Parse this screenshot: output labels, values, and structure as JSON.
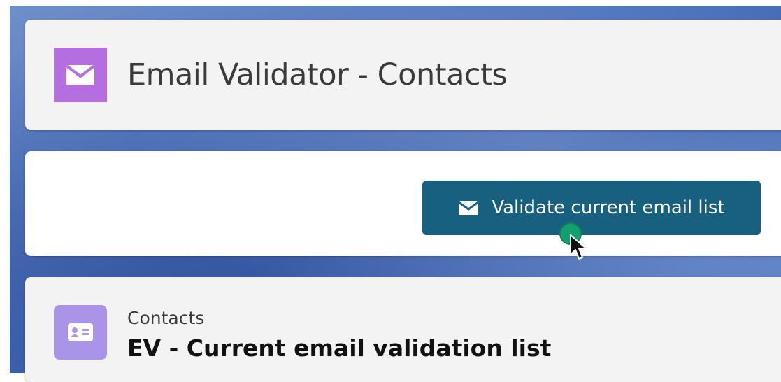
{
  "header": {
    "title": "Email Validator - Contacts",
    "icon": "envelope-icon",
    "icon_color": "#b56ee0"
  },
  "actions": {
    "validate_label": "Validate current email list",
    "validate_icon": "envelope-icon",
    "button_color": "#17607f"
  },
  "list": {
    "object_label": "Contacts",
    "title": "EV - Current email validation list",
    "icon": "contact-card-icon",
    "icon_color": "#a994e8"
  }
}
